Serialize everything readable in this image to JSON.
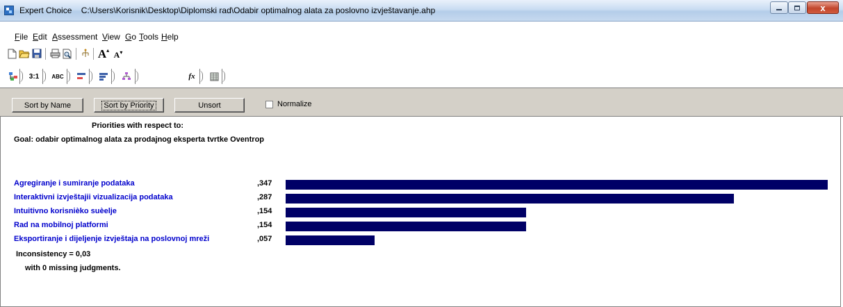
{
  "window": {
    "app_name": "Expert Choice",
    "file_path": "C:\\Users\\Korisnik\\Desktop\\Diplomski rad\\Odabir optimalnog alata za poslovno izvještavanje.ahp"
  },
  "menu": [
    "File",
    "Edit",
    "Assessment",
    "View",
    "Go",
    "Tools",
    "Help"
  ],
  "toolbar_icons": [
    "new-file-icon",
    "open-folder-icon",
    "save-icon",
    "print-icon",
    "print-preview-icon",
    "model-icon",
    "increase-font-icon",
    "decrease-font-icon"
  ],
  "tabs": [
    {
      "icon": "tree-view-icon",
      "label": ""
    },
    {
      "icon": "",
      "label": "3:1"
    },
    {
      "icon": "",
      "label": "ABC"
    },
    {
      "icon": "priorities-graph-icon",
      "label": ""
    },
    {
      "icon": "sorted-priorities-icon",
      "label": ""
    },
    {
      "icon": "synthesis-icon",
      "label": ""
    },
    {
      "icon": "formula-icon",
      "label": "fx"
    },
    {
      "icon": "data-grid-icon",
      "label": ""
    }
  ],
  "sortbar": {
    "sort_by_name": "Sort by Name",
    "sort_by_priority": "Sort by Priority",
    "unsort": "Unsort",
    "normalize": "Normalize",
    "normalize_checked": false
  },
  "content": {
    "priorities_heading": "Priorities with respect to:",
    "goal": "Goal: odabir optimalnog alata za prodajnog eksperta tvrtke Oventrop",
    "items": [
      {
        "label": "Agregiranje i sumiranje podataka",
        "value": ",347",
        "priority": 0.347
      },
      {
        "label": "Interaktivni izvještajii vizualizacija podataka",
        "value": ",287",
        "priority": 0.287
      },
      {
        "label": "Intuitivno korisnièko suèelje",
        "value": ",154",
        "priority": 0.154
      },
      {
        "label": "Rad na mobilnoj platformi",
        "value": ",154",
        "priority": 0.154
      },
      {
        "label": "Eksportiranje i dijeljenje izvještaja na poslovnoj mreži",
        "value": ",057",
        "priority": 0.057
      }
    ],
    "inconsistency": "Inconsistency = 0,03",
    "missing": "with 0  missing judgments."
  },
  "colors": {
    "bar": "#000066",
    "label": "#0000cc",
    "sortbar_bg": "#d4d0c8"
  }
}
